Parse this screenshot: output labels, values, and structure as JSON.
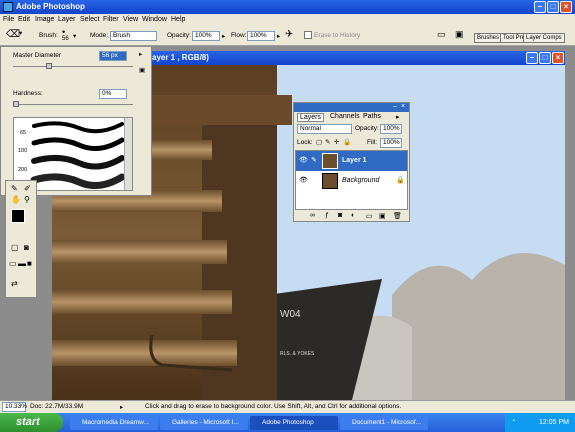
{
  "app": {
    "title": "Adobe Photoshop"
  },
  "menu": [
    "File",
    "Edit",
    "Image",
    "Layer",
    "Select",
    "Filter",
    "View",
    "Window",
    "Help"
  ],
  "options": {
    "brush_label": "Brush:",
    "brush_size": "56",
    "mode_label": "Mode:",
    "mode_value": "Brush",
    "opacity_label": "Opacity:",
    "opacity_value": "100%",
    "flow_label": "Flow:",
    "flow_value": "100%",
    "erase_history": "Erase to History",
    "tabs": [
      "Brushes",
      "Tool Pre",
      "Layer Comps"
    ]
  },
  "brush_panel": {
    "diameter_label": "Master Diameter",
    "diameter_value": "56 px",
    "hardness_label": "Hardness:",
    "hardness_value": "0%",
    "presets": [
      "65",
      "100",
      "200",
      "300"
    ]
  },
  "document": {
    "title": "ayer 1 , RGB/8)",
    "text1": "W04",
    "text2": "RLS. & YOKES"
  },
  "layers": {
    "tabs": [
      "Layers",
      "Channels",
      "Paths"
    ],
    "mode": "Normal",
    "opacity_label": "Opacity:",
    "opacity_value": "100%",
    "lock_label": "Lock:",
    "fill_label": "Fill:",
    "fill_value": "100%",
    "items": [
      {
        "name": "Layer 1"
      },
      {
        "name": "Background"
      }
    ]
  },
  "status": {
    "zoom": "10.33%",
    "doc": "Doc: 22.7M/33.9M",
    "hint": "Click and drag to erase to background color. Use Shift, Alt, and Ctrl for additional options."
  },
  "taskbar": {
    "start": "start",
    "tasks": [
      "Macromedia Dreamw...",
      "Galleries - Microsoft I...",
      "Adobe Photoshop",
      "Document1 - Microsof..."
    ],
    "time": "12:05 PM"
  },
  "colors": {
    "xp_blue": "#2a64e6",
    "taskbar": "#2460d8",
    "selection": "#316ac5",
    "start_green": "#2d8f2d"
  }
}
